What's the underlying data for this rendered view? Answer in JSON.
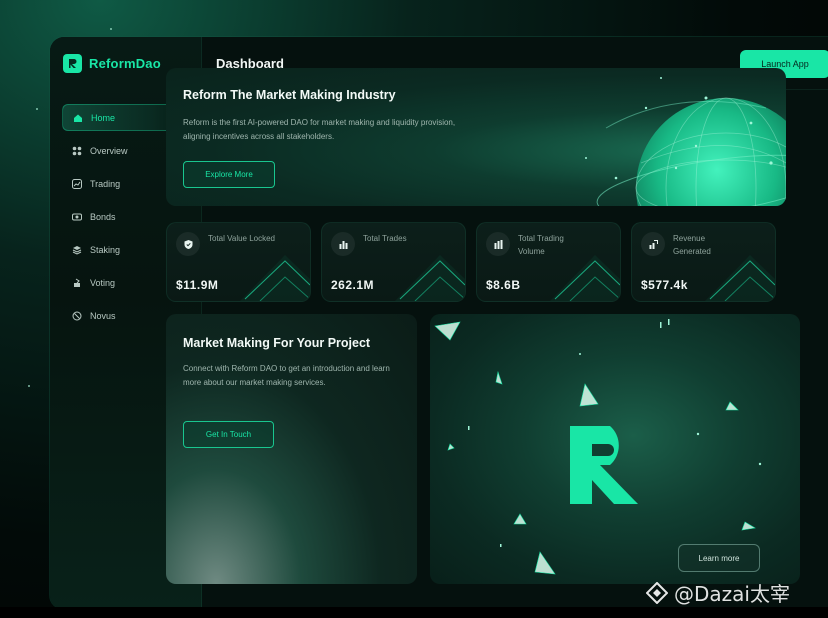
{
  "brand": {
    "name": "ReformDao",
    "accent": "#19e6a6"
  },
  "sidebar": {
    "items": [
      {
        "label": "Home",
        "icon": "home-icon",
        "active": true
      },
      {
        "label": "Overview",
        "icon": "grid-icon",
        "active": false
      },
      {
        "label": "Trading",
        "icon": "trading-icon",
        "active": false
      },
      {
        "label": "Bonds",
        "icon": "bonds-icon",
        "active": false
      },
      {
        "label": "Staking",
        "icon": "stack-icon",
        "active": false
      },
      {
        "label": "Voting",
        "icon": "vote-icon",
        "active": false
      },
      {
        "label": "Novus",
        "icon": "novus-icon",
        "active": false
      }
    ]
  },
  "header": {
    "title": "Dashboard",
    "launch_label": "Launch App"
  },
  "hero": {
    "title": "Reform The Market Making Industry",
    "description": "Reform is the first AI-powered DAO for market making and liquidity provision, aligning incentives across all stakeholders.",
    "button_label": "Explore More"
  },
  "stats": [
    {
      "label": "Total Value Locked",
      "value": "$11.9M",
      "icon": "shield-icon"
    },
    {
      "label": "Total Trades",
      "value": "262.1M",
      "icon": "trades-icon"
    },
    {
      "label": "Total Trading Volume",
      "value": "$8.6B",
      "icon": "bar-chart-icon"
    },
    {
      "label": "Revenue Generated",
      "value": "$577.4k",
      "icon": "revenue-icon"
    }
  ],
  "market_making": {
    "title": "Market Making For Your Project",
    "description": "Connect with Reform DAO to get an introduction and learn more about our market making services.",
    "button_label": "Get In Touch"
  },
  "art_card": {
    "button_label": "Learn more"
  },
  "watermark": {
    "text": "@Dazai太宰"
  }
}
